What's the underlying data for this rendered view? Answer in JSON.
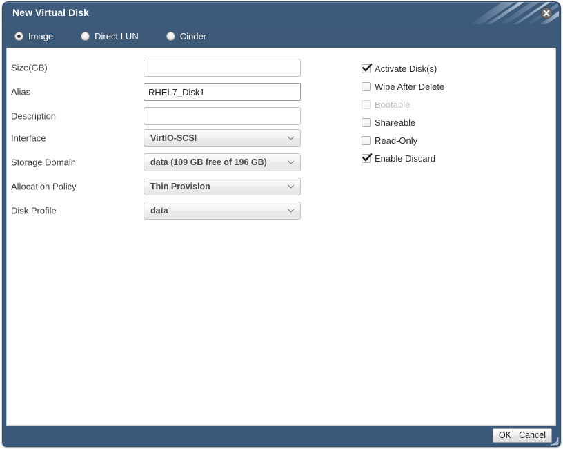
{
  "window": {
    "title": "New Virtual Disk",
    "close_icon": "close-icon",
    "resize_grip_icon": "resize-grip-icon"
  },
  "theme": {
    "titlebar_bg": "#3b5a7c",
    "tabband_bg": "#3e5a79",
    "frame": "#3a587a",
    "content_bg": "#ffffff",
    "label_color": "#3d3d3d",
    "select_text_color": "#4a4a4a"
  },
  "disk_type_tabs": {
    "selected": "Image",
    "options": [
      {
        "label": "Image",
        "selected": true
      },
      {
        "label": "Direct LUN",
        "selected": false
      },
      {
        "label": "Cinder",
        "selected": false
      }
    ]
  },
  "form": {
    "fields": [
      {
        "label": "Size(GB)",
        "control": "text",
        "value": "",
        "placeholder": "",
        "focused": false
      },
      {
        "label": "Alias",
        "control": "text",
        "value": "RHEL7_Disk1",
        "placeholder": "",
        "focused": true
      },
      {
        "label": "Description",
        "control": "text",
        "value": "",
        "placeholder": "",
        "focused": false
      },
      {
        "label": "Interface",
        "control": "select",
        "value": "VirtIO-SCSI",
        "arrow_icon": "chevron-down-icon"
      },
      {
        "label": "Storage Domain",
        "control": "select",
        "value": "data (109 GB free of 196 GB)",
        "arrow_icon": "chevron-down-icon"
      },
      {
        "label": "Allocation Policy",
        "control": "select",
        "value": "Thin Provision",
        "arrow_icon": "chevron-down-icon"
      },
      {
        "label": "Disk Profile",
        "control": "select",
        "value": "data",
        "arrow_icon": "chevron-down-icon"
      }
    ]
  },
  "options": {
    "checkboxes": [
      {
        "label": "Activate Disk(s)",
        "checked": true,
        "disabled": false
      },
      {
        "label": "Wipe After Delete",
        "checked": false,
        "disabled": false
      },
      {
        "label": "Bootable",
        "checked": false,
        "disabled": true
      },
      {
        "label": "Shareable",
        "checked": false,
        "disabled": false
      },
      {
        "label": "Read-Only",
        "checked": false,
        "disabled": false
      },
      {
        "label": "Enable Discard",
        "checked": true,
        "disabled": false
      }
    ]
  },
  "footer": {
    "ok_label": "OK",
    "cancel_label": "Cancel"
  }
}
